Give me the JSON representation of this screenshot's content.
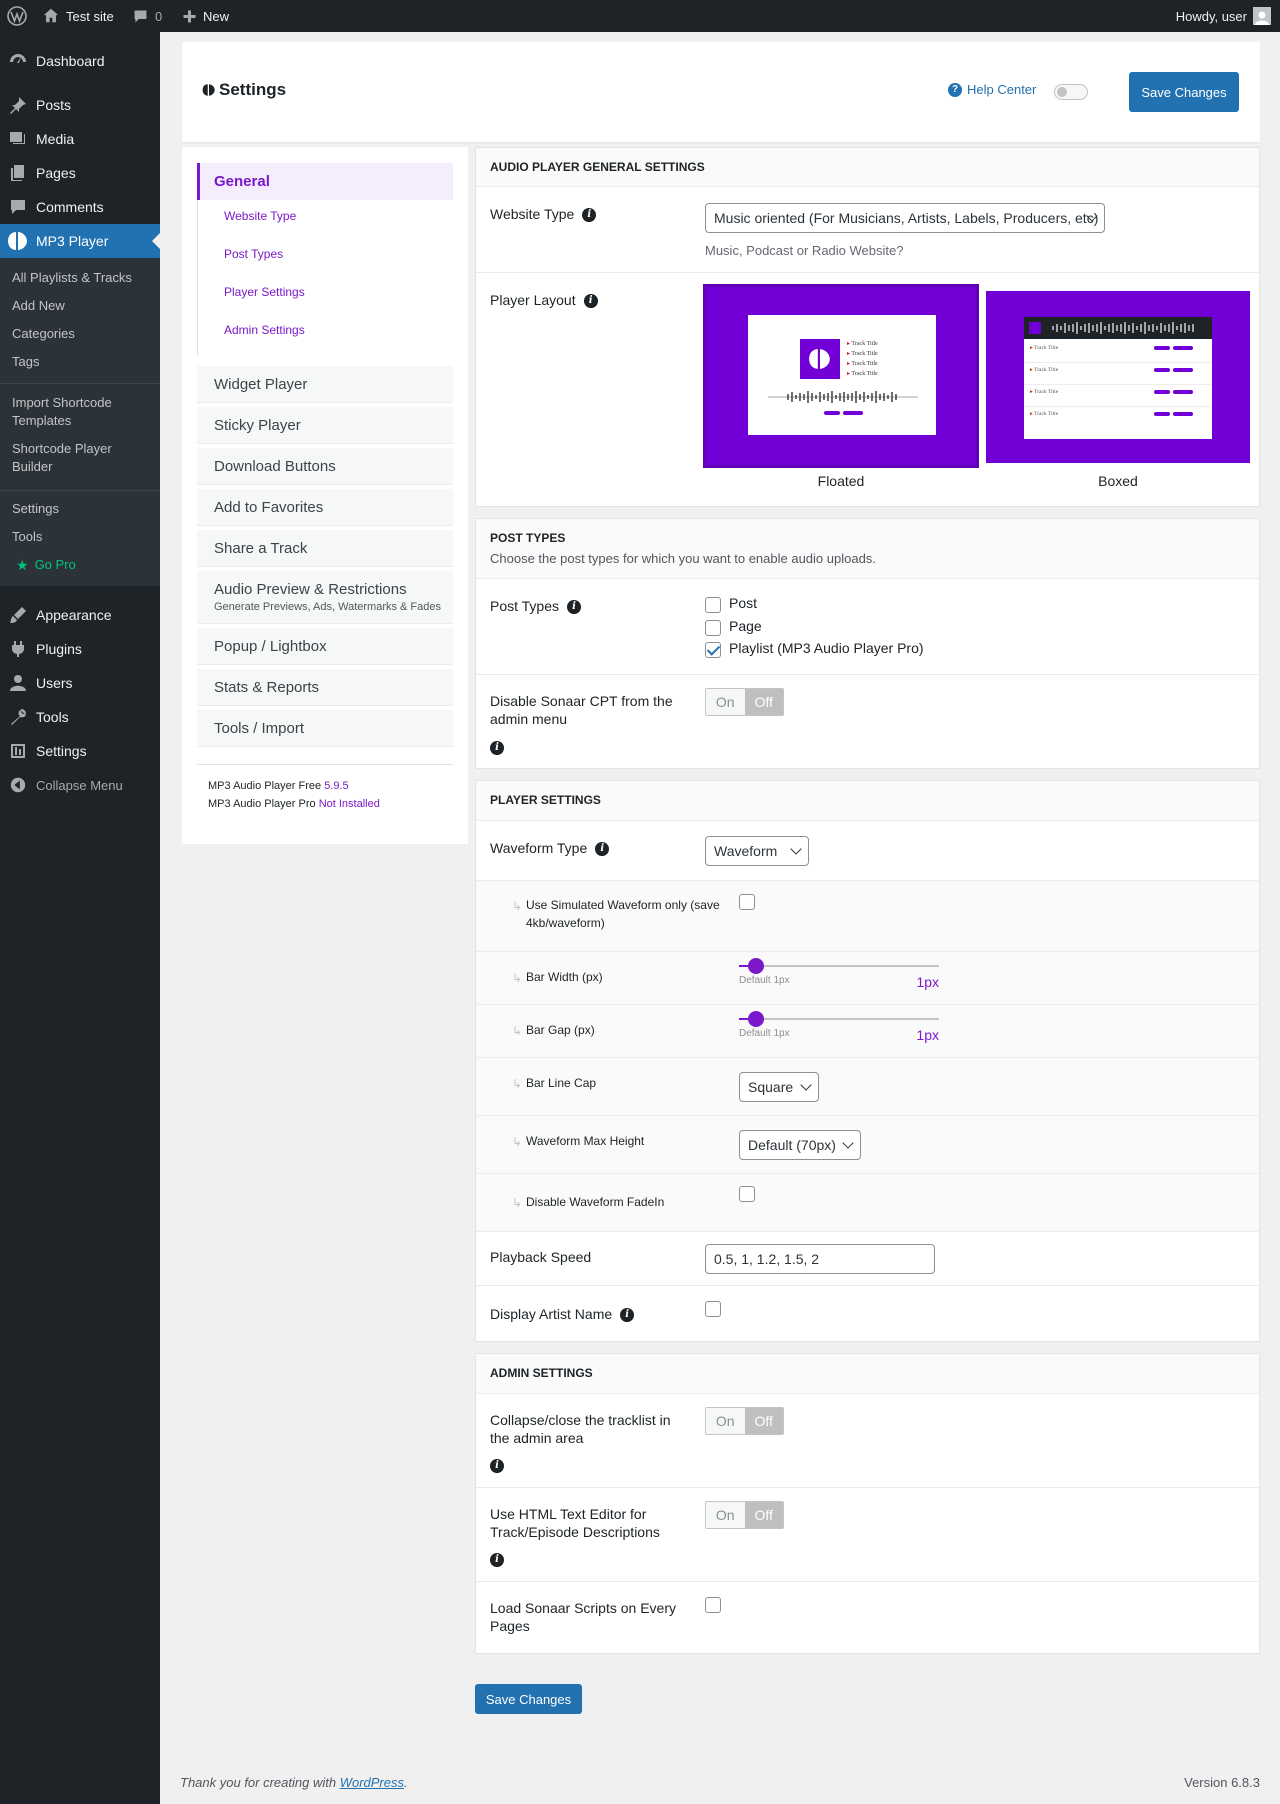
{
  "adminbar": {
    "site_name": "Test site",
    "comments_count": "0",
    "new_label": "New",
    "howdy": "Howdy, user"
  },
  "menu": {
    "dashboard": "Dashboard",
    "posts": "Posts",
    "media": "Media",
    "pages": "Pages",
    "comments": "Comments",
    "mp3_player": "MP3 Player",
    "sub": {
      "all_playlists": "All Playlists & Tracks",
      "add_new": "Add New",
      "categories": "Categories",
      "tags": "Tags",
      "import_shortcode": "Import Shortcode Templates",
      "shortcode_builder": "Shortcode Player Builder",
      "settings": "Settings",
      "tools": "Tools",
      "go_pro": "Go Pro"
    },
    "appearance": "Appearance",
    "plugins": "Plugins",
    "users": "Users",
    "tools": "Tools",
    "settings": "Settings",
    "collapse": "Collapse Menu"
  },
  "header": {
    "title": "Settings",
    "help_center": "Help Center",
    "save_label": "Save Changes"
  },
  "nav": {
    "general": "General",
    "general_sub": [
      "Website Type",
      "Post Types",
      "Player Settings",
      "Admin Settings"
    ],
    "items": [
      "Widget Player",
      "Sticky Player",
      "Download Buttons",
      "Add to Favorites",
      "Share a Track"
    ],
    "audio_preview": "Audio Preview & Restrictions",
    "audio_preview_sub": "Generate Previews, Ads, Watermarks & Fades",
    "items2": [
      "Popup / Lightbox",
      "Stats & Reports",
      "Tools / Import"
    ],
    "footer_free": "MP3 Audio Player Free",
    "footer_free_version": "5.9.5",
    "footer_pro": "MP3 Audio Player Pro",
    "footer_pro_status": "Not Installed"
  },
  "general_section": {
    "title": "Audio Player General Settings",
    "website_type_label": "Website Type",
    "website_type_value": "Music oriented (For Musicians, Artists, Labels, Producers, etc)",
    "website_type_hint": "Music, Podcast or Radio Website?",
    "player_layout_label": "Player Layout",
    "layout_floated": "Floated",
    "layout_boxed": "Boxed",
    "preview_track_title": "Track Title"
  },
  "post_types_section": {
    "title": "Post Types",
    "description": "Choose the post types for which you want to enable audio uploads.",
    "label": "Post Types",
    "options": [
      {
        "label": "Post",
        "checked": false
      },
      {
        "label": "Page",
        "checked": false
      },
      {
        "label": "Playlist (MP3 Audio Player Pro)",
        "checked": true
      }
    ],
    "disable_cpt_label": "Disable Sonaar CPT from the admin menu",
    "on": "On",
    "off": "Off"
  },
  "player_section": {
    "title": "Player Settings",
    "waveform_type_label": "Waveform Type",
    "waveform_type_value": "Waveform",
    "simulated_label": "Use Simulated Waveform only (save 4kb/waveform)",
    "bar_width_label": "Bar Width (px)",
    "bar_width_default": "Default 1px",
    "bar_width_value": "1px",
    "bar_gap_label": "Bar Gap (px)",
    "bar_gap_default": "Default 1px",
    "bar_gap_value": "1px",
    "line_cap_label": "Bar Line Cap",
    "line_cap_value": "Square",
    "max_height_label": "Waveform Max Height",
    "max_height_value": "Default (70px)",
    "fadein_label": "Disable Waveform FadeIn",
    "playback_label": "Playback Speed",
    "playback_value": "0.5, 1, 1.2, 1.5, 2",
    "artist_label": "Display Artist Name",
    "arrow": "↳"
  },
  "admin_section": {
    "title": "Admin Settings",
    "collapse_label": "Collapse/close the tracklist in the admin area",
    "html_editor_label": "Use HTML Text Editor for Track/Episode Descriptions",
    "load_scripts_label": "Load Sonaar Scripts on Every Pages",
    "on": "On",
    "off": "Off"
  },
  "save_bottom": "Save Changes",
  "footer": {
    "thanks": "Thank you for creating with",
    "wp_link": "WordPress",
    "version": "Version 6.8.3"
  },
  "colors": {
    "accent": "#7b18c9",
    "wp_blue": "#2271b1",
    "menu_bg": "#1d2327",
    "preview_bg": "#7200d6"
  }
}
